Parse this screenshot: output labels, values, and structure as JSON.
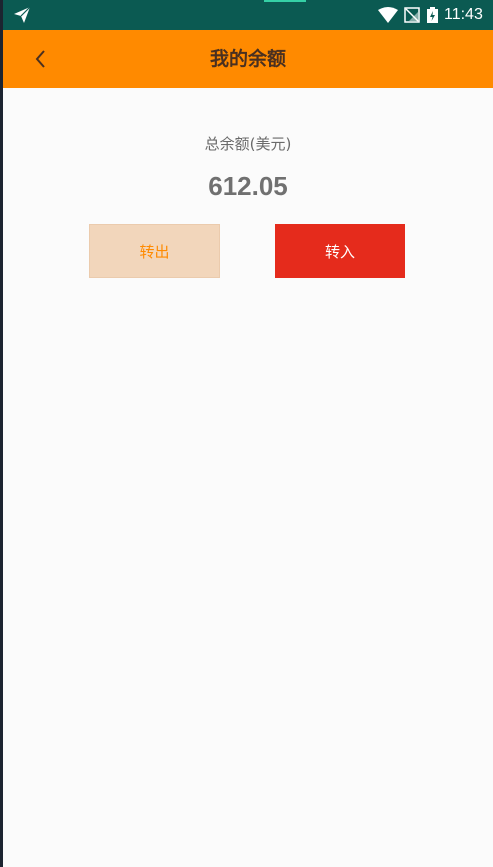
{
  "status_bar": {
    "time": "11:43",
    "icons": [
      "send-icon",
      "wifi-icon",
      "no-signal-icon",
      "battery-charging-icon"
    ]
  },
  "app_bar": {
    "title": "我的余额",
    "back_icon": "chevron-left-icon"
  },
  "balance": {
    "label": "总余额(美元)",
    "value": "612.05"
  },
  "actions": {
    "transfer_out_label": "转出",
    "transfer_in_label": "转入"
  },
  "colors": {
    "status_bar_bg": "#0b5a52",
    "app_bar_bg": "#ff8a00",
    "transfer_out_bg": "#f2d6bb",
    "transfer_out_text": "#ff8a00",
    "transfer_in_bg": "#e52b1c",
    "transfer_in_text": "#ffffff"
  }
}
